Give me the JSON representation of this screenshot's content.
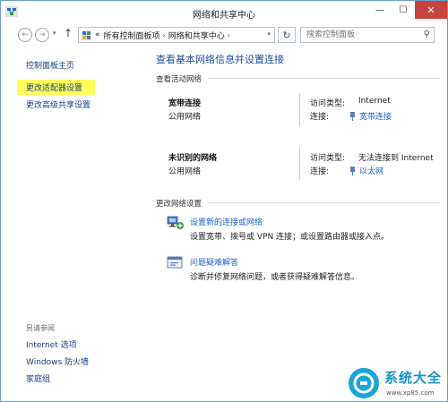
{
  "window": {
    "title": "网络和共享中心",
    "minimize_glyph": "—",
    "maximize_glyph": "☐",
    "close_glyph": "✕"
  },
  "nav": {
    "back_glyph": "←",
    "forward_glyph": "→",
    "recent_glyph": "▾",
    "up_glyph": "↑",
    "breadcrumb_prefix": "«",
    "breadcrumb": [
      "所有控制面板项",
      "网络和共享中心"
    ],
    "breadcrumb_sep": "›",
    "address_dropdown": "▾",
    "refresh_glyph": "↻",
    "search_placeholder": "搜索控制面板",
    "search_glyph": "⚲"
  },
  "sidebar": {
    "home": "控制面板主页",
    "links": [
      "更改适配器设置",
      "更改高级共享设置"
    ],
    "highlighted_index": 0,
    "highlight_color": "#ffff5e",
    "see_also_label": "另请参阅",
    "see_also": [
      "Internet 选项",
      "Windows 防火墙",
      "家庭组"
    ]
  },
  "main": {
    "title": "查看基本网络信息并设置连接",
    "active_networks_label": "查看活动网络",
    "networks": [
      {
        "name": "宽带连接",
        "kind": "公用网络",
        "access_label": "访问类型:",
        "access_value": "Internet",
        "conn_label": "连接:",
        "conn_value": "宽带连接"
      },
      {
        "name": "未识别的网络",
        "kind": "公用网络",
        "access_label": "访问类型:",
        "access_value": "无法连接到 Internet",
        "conn_label": "连接:",
        "conn_value": "以太网"
      }
    ],
    "change_settings_label": "更改网络设置",
    "tasks": [
      {
        "icon": "new-connection-icon",
        "link": "设置新的连接或网络",
        "desc": "设置宽带、拨号或 VPN 连接；或设置路由器或接入点。"
      },
      {
        "icon": "troubleshoot-icon",
        "link": "问题疑难解答",
        "desc": "诊断并修复网络问题，或者获得疑难解答信息。"
      }
    ],
    "link_color": "#1f62c7",
    "title_color": "#1d4fa0"
  },
  "watermark": {
    "title": "系统大全",
    "url": "www.xp85.com"
  }
}
